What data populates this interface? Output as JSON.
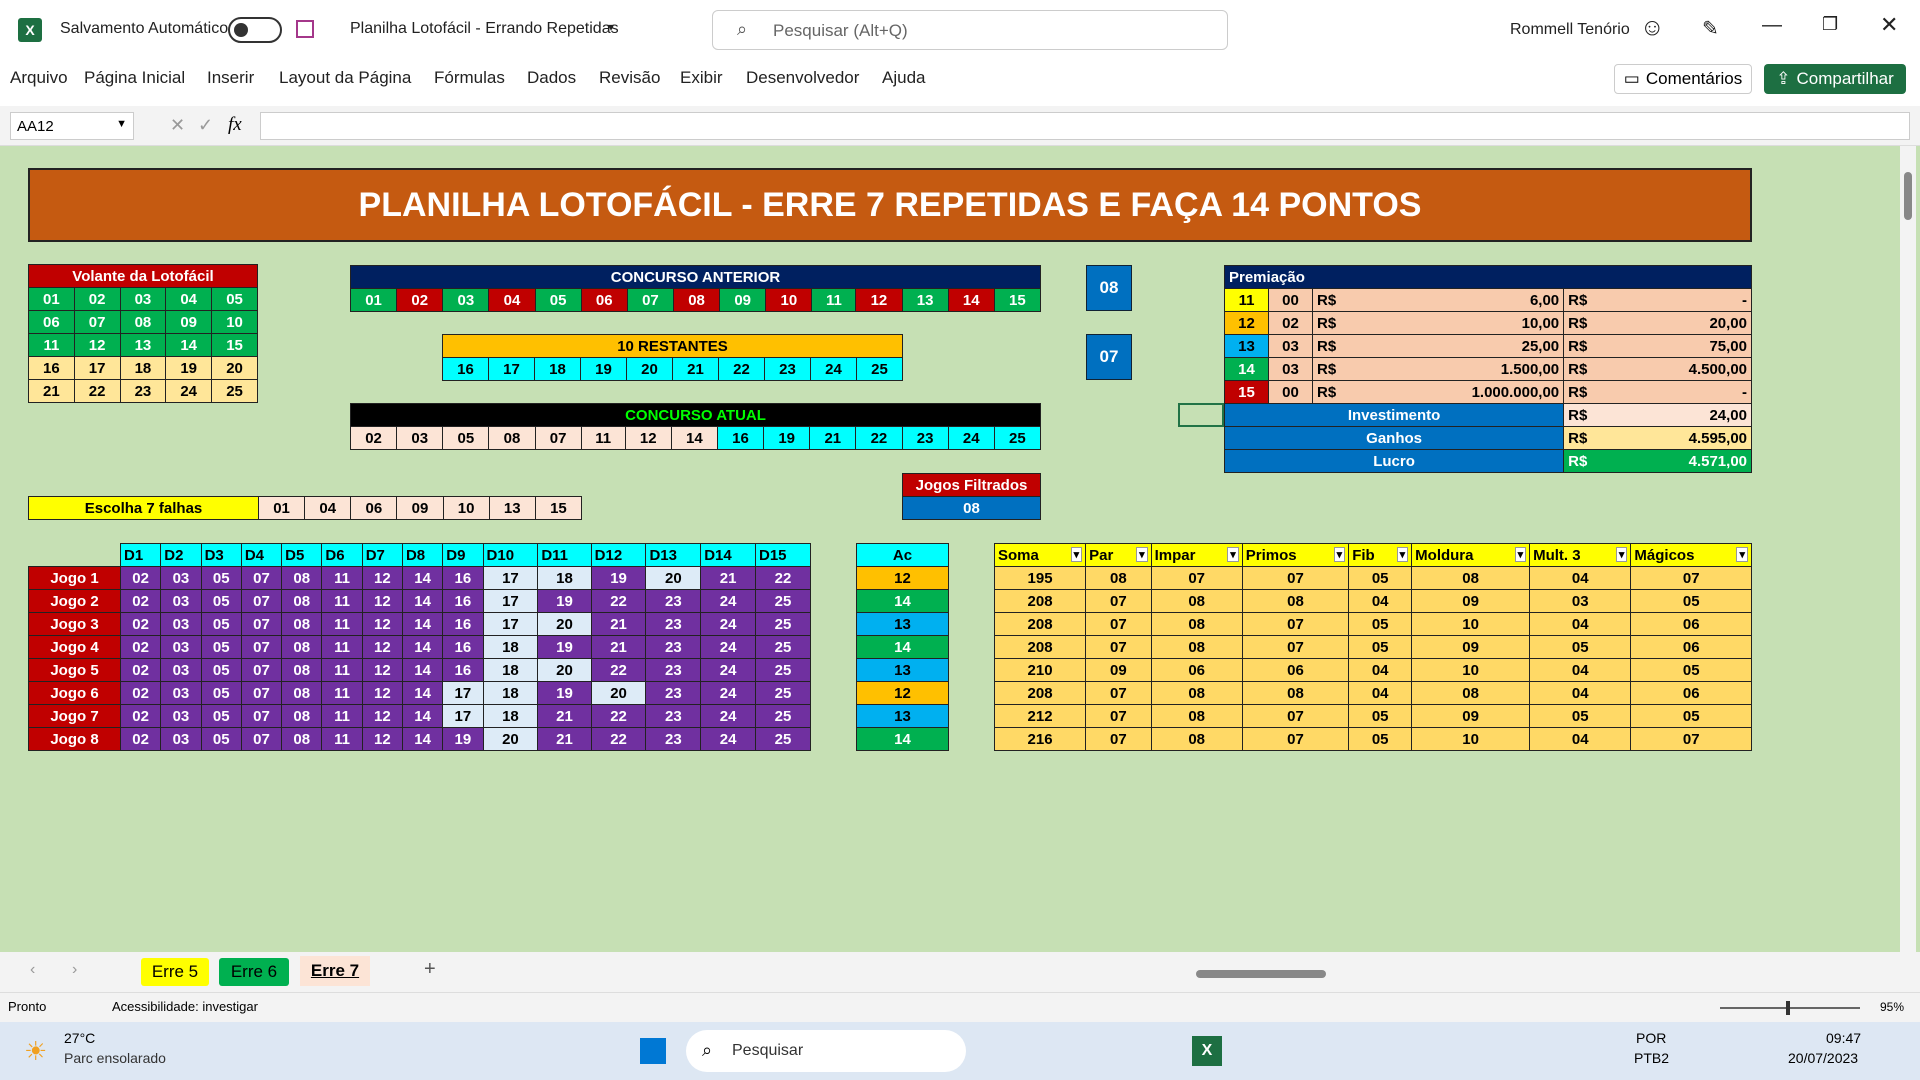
{
  "titlebar": {
    "autosave": "Salvamento Automático",
    "doc_title": "Planilha Lotofácil - Errando Repetidas",
    "search_placeholder": "Pesquisar (Alt+Q)",
    "user": "Rommell Tenório"
  },
  "ribbon": {
    "tabs": [
      "Arquivo",
      "Página Inicial",
      "Inserir",
      "Layout da Página",
      "Fórmulas",
      "Dados",
      "Revisão",
      "Exibir",
      "Desenvolvedor",
      "Ajuda"
    ],
    "comments": "Comentários",
    "share": "Compartilhar"
  },
  "formula": {
    "namebox": "AA12",
    "fx": "fx"
  },
  "banner": "PLANILHA LOTOFÁCIL - ERRE 7 REPETIDAS E FAÇA 14 PONTOS",
  "volante": {
    "title": "Volante da Lotofácil",
    "rows": [
      [
        "01",
        "02",
        "03",
        "04",
        "05"
      ],
      [
        "06",
        "07",
        "08",
        "09",
        "10"
      ],
      [
        "11",
        "12",
        "13",
        "14",
        "15"
      ],
      [
        "16",
        "17",
        "18",
        "19",
        "20"
      ],
      [
        "21",
        "22",
        "23",
        "24",
        "25"
      ]
    ]
  },
  "anterior": {
    "title": "CONCURSO ANTERIOR",
    "nums": [
      "01",
      "02",
      "03",
      "04",
      "05",
      "06",
      "07",
      "08",
      "09",
      "10",
      "11",
      "12",
      "13",
      "14",
      "15"
    ]
  },
  "restantes": {
    "title": "10 RESTANTES",
    "nums": [
      "16",
      "17",
      "18",
      "19",
      "20",
      "21",
      "22",
      "23",
      "24",
      "25"
    ]
  },
  "atual": {
    "title": "CONCURSO ATUAL",
    "nums": [
      "02",
      "03",
      "05",
      "08",
      "07",
      "11",
      "12",
      "14",
      "16",
      "19",
      "21",
      "22",
      "23",
      "24",
      "25"
    ]
  },
  "box1": "08",
  "box2": "07",
  "filtrados": {
    "title": "Jogos Filtrados",
    "value": "08"
  },
  "falhas": {
    "label": "Escolha 7 falhas",
    "nums": [
      "01",
      "04",
      "06",
      "09",
      "10",
      "13",
      "15"
    ]
  },
  "premiacao": {
    "title": "Premiação",
    "rows": [
      {
        "pts": "11",
        "qty": "00",
        "cur": "R$",
        "val": "6,00",
        "cur2": "R$",
        "total": "-"
      },
      {
        "pts": "12",
        "qty": "02",
        "cur": "R$",
        "val": "10,00",
        "cur2": "R$",
        "total": "20,00"
      },
      {
        "pts": "13",
        "qty": "03",
        "cur": "R$",
        "val": "25,00",
        "cur2": "R$",
        "total": "75,00"
      },
      {
        "pts": "14",
        "qty": "03",
        "cur": "R$",
        "val": "1.500,00",
        "cur2": "R$",
        "total": "4.500,00"
      },
      {
        "pts": "15",
        "qty": "00",
        "cur": "R$",
        "val": "1.000.000,00",
        "cur2": "R$",
        "total": "-"
      }
    ],
    "summary": [
      {
        "label": "Investimento",
        "cur": "R$",
        "val": "24,00"
      },
      {
        "label": "Ganhos",
        "cur": "R$",
        "val": "4.595,00"
      },
      {
        "label": "Lucro",
        "cur": "R$",
        "val": "4.571,00"
      }
    ]
  },
  "jogos": {
    "headers": [
      "D1",
      "D2",
      "D3",
      "D4",
      "D5",
      "D6",
      "D7",
      "D8",
      "D9",
      "D10",
      "D11",
      "D12",
      "D13",
      "D14",
      "D15"
    ],
    "rows": [
      {
        "label": "Jogo 1",
        "nums": [
          "02",
          "03",
          "05",
          "07",
          "08",
          "11",
          "12",
          "14",
          "16",
          "17",
          "18",
          "19",
          "20",
          "21",
          "22"
        ],
        "ac": "12"
      },
      {
        "label": "Jogo 2",
        "nums": [
          "02",
          "03",
          "05",
          "07",
          "08",
          "11",
          "12",
          "14",
          "16",
          "17",
          "19",
          "22",
          "23",
          "24",
          "25"
        ],
        "ac": "14"
      },
      {
        "label": "Jogo 3",
        "nums": [
          "02",
          "03",
          "05",
          "07",
          "08",
          "11",
          "12",
          "14",
          "16",
          "17",
          "20",
          "21",
          "23",
          "24",
          "25"
        ],
        "ac": "13"
      },
      {
        "label": "Jogo 4",
        "nums": [
          "02",
          "03",
          "05",
          "07",
          "08",
          "11",
          "12",
          "14",
          "16",
          "18",
          "19",
          "21",
          "23",
          "24",
          "25"
        ],
        "ac": "14"
      },
      {
        "label": "Jogo 5",
        "nums": [
          "02",
          "03",
          "05",
          "07",
          "08",
          "11",
          "12",
          "14",
          "16",
          "18",
          "20",
          "22",
          "23",
          "24",
          "25"
        ],
        "ac": "13"
      },
      {
        "label": "Jogo 6",
        "nums": [
          "02",
          "03",
          "05",
          "07",
          "08",
          "11",
          "12",
          "14",
          "17",
          "18",
          "19",
          "20",
          "23",
          "24",
          "25"
        ],
        "ac": "12"
      },
      {
        "label": "Jogo 7",
        "nums": [
          "02",
          "03",
          "05",
          "07",
          "08",
          "11",
          "12",
          "14",
          "17",
          "18",
          "21",
          "22",
          "23",
          "24",
          "25"
        ],
        "ac": "13"
      },
      {
        "label": "Jogo 8",
        "nums": [
          "02",
          "03",
          "05",
          "07",
          "08",
          "11",
          "12",
          "14",
          "19",
          "20",
          "21",
          "22",
          "23",
          "24",
          "25"
        ],
        "ac": "14"
      }
    ],
    "ac_header": "Ac"
  },
  "stats": {
    "headers": [
      "Soma",
      "Par",
      "Impar",
      "Primos",
      "Fib",
      "Moldura",
      "Mult. 3",
      "Mágicos"
    ],
    "rows": [
      [
        "195",
        "08",
        "07",
        "07",
        "05",
        "08",
        "04",
        "07"
      ],
      [
        "208",
        "07",
        "08",
        "08",
        "04",
        "09",
        "03",
        "05"
      ],
      [
        "208",
        "07",
        "08",
        "07",
        "05",
        "10",
        "04",
        "06"
      ],
      [
        "208",
        "07",
        "08",
        "07",
        "05",
        "09",
        "05",
        "06"
      ],
      [
        "210",
        "09",
        "06",
        "06",
        "04",
        "10",
        "04",
        "05"
      ],
      [
        "208",
        "07",
        "08",
        "08",
        "04",
        "08",
        "04",
        "06"
      ],
      [
        "212",
        "07",
        "08",
        "07",
        "05",
        "09",
        "05",
        "05"
      ],
      [
        "216",
        "07",
        "08",
        "07",
        "05",
        "10",
        "04",
        "07"
      ]
    ]
  },
  "sheet_tabs": [
    "Erre 5",
    "Erre 6",
    "Erre 7"
  ],
  "status": {
    "ready": "Pronto",
    "access": "Acessibilidade: investigar",
    "zoom": "95%"
  },
  "taskbar": {
    "temp": "27°C",
    "weather": "Parc ensolarado",
    "search": "Pesquisar",
    "lang1": "POR",
    "lang2": "PTB2",
    "time": "09:47",
    "date": "20/07/2023"
  }
}
